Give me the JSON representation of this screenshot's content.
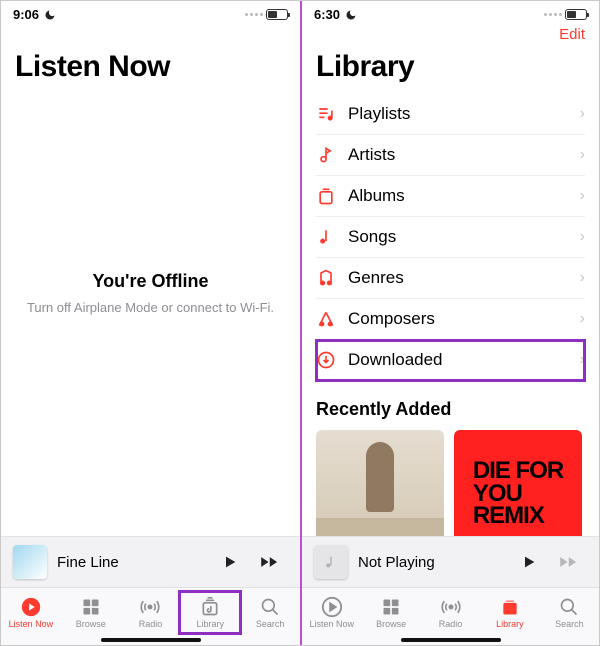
{
  "left": {
    "status_time": "9:06",
    "title": "Listen Now",
    "offline_title": "You're Offline",
    "offline_sub": "Turn off Airplane Mode or connect to Wi-Fi.",
    "now_playing": "Fine Line",
    "tabs": [
      "Listen Now",
      "Browse",
      "Radio",
      "Library",
      "Search"
    ],
    "active_tab": 0,
    "highlight_tab": 3
  },
  "right": {
    "status_time": "6:30",
    "edit_label": "Edit",
    "title": "Library",
    "items": [
      {
        "label": "Playlists"
      },
      {
        "label": "Artists"
      },
      {
        "label": "Albums"
      },
      {
        "label": "Songs"
      },
      {
        "label": "Genres"
      },
      {
        "label": "Composers"
      },
      {
        "label": "Downloaded"
      }
    ],
    "highlight_item": 6,
    "recent_header": "Recently Added",
    "remix_text": "DIE FOR\nYOU\nREMIX",
    "now_playing": "Not Playing",
    "tabs": [
      "Listen Now",
      "Browse",
      "Radio",
      "Library",
      "Search"
    ],
    "active_tab": 3
  }
}
